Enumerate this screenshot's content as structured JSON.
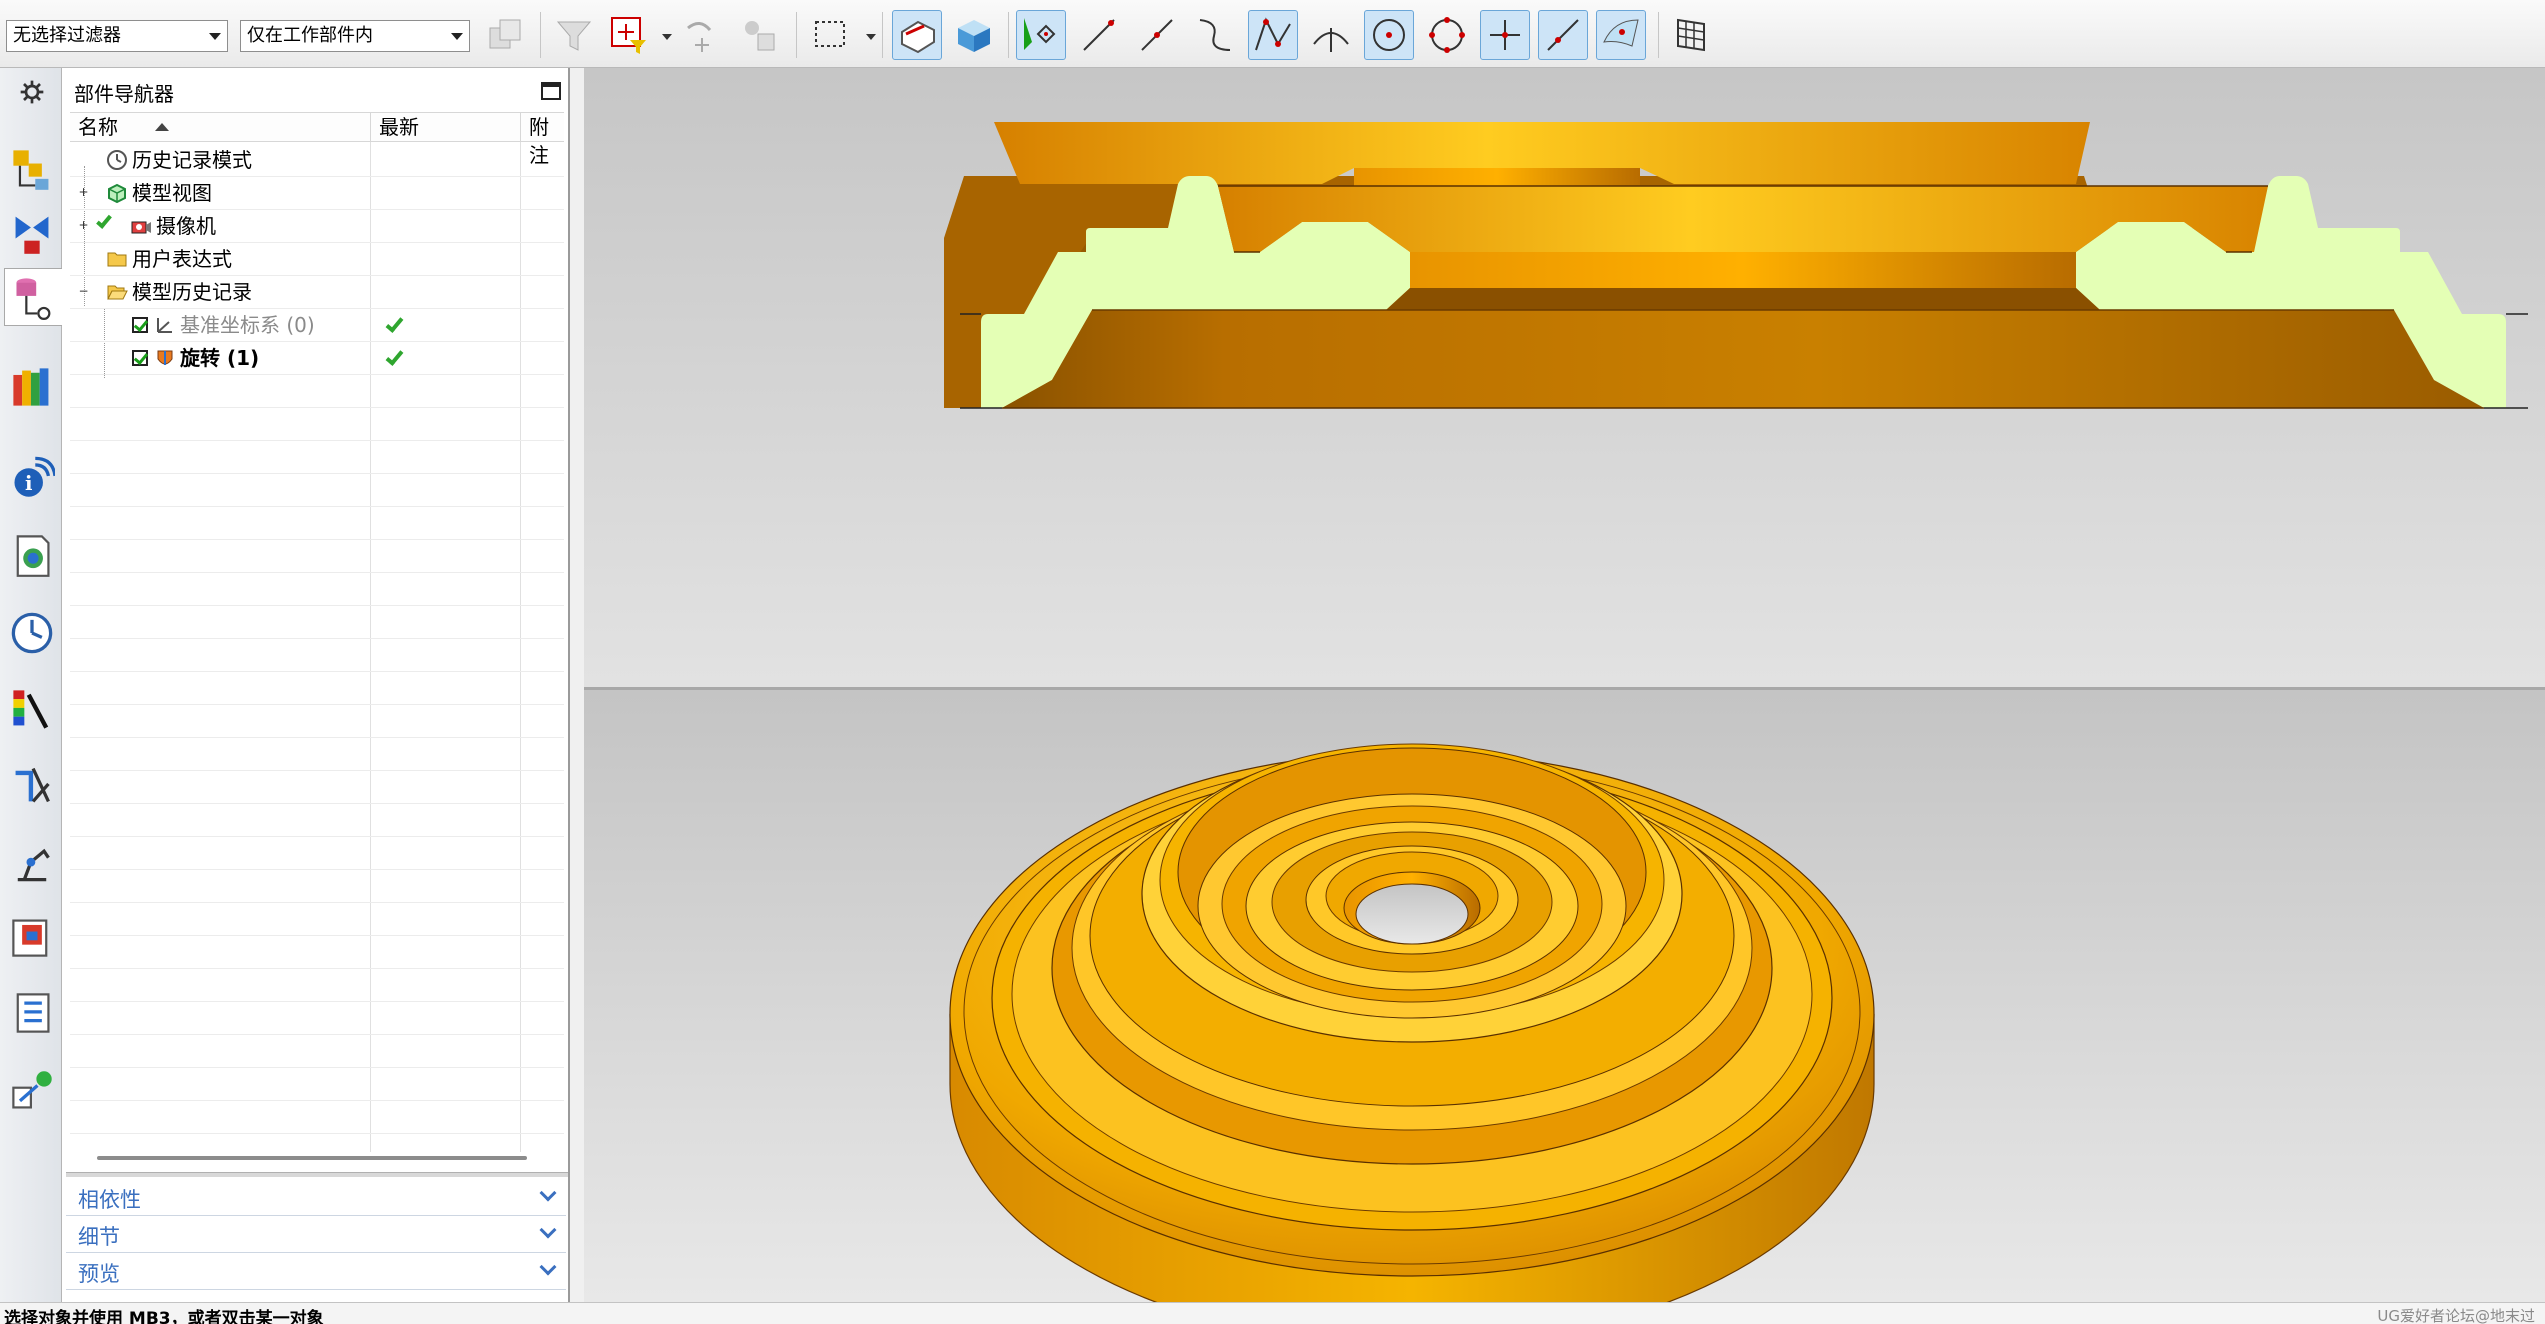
{
  "toolbar": {
    "filter_select": "无选择过滤器",
    "scope_select": "仅在工作部件内"
  },
  "navigator": {
    "title": "部件导航器",
    "columns": [
      "名称",
      "最新",
      "附注"
    ],
    "rows": [
      {
        "label": "历史记录模式",
        "icon": "clock-icon",
        "expander": ""
      },
      {
        "label": "模型视图",
        "icon": "model-views-icon",
        "expander": "+"
      },
      {
        "label": "摄像机",
        "icon": "camera-icon",
        "expander": "+"
      },
      {
        "label": "用户表达式",
        "icon": "folder-icon",
        "expander": ""
      },
      {
        "label": "模型历史记录",
        "icon": "folder-open-icon",
        "expander": "−"
      },
      {
        "label": "基准坐标系 (0)",
        "icon": "datum-csys-icon",
        "expander": ""
      },
      {
        "label": "旋转 (1)",
        "icon": "revolve-icon",
        "expander": ""
      }
    ]
  },
  "panels": [
    "相依性",
    "细节",
    "预览"
  ],
  "status": {
    "message": "选择对象并使用 MB3，或者双击某一对象",
    "watermark": "UG爱好者论坛@地末过"
  },
  "colors": {
    "part_orange": "#f0a000",
    "section_green": "#e6ffb6",
    "viewport_gray": "#d6d6d6"
  }
}
